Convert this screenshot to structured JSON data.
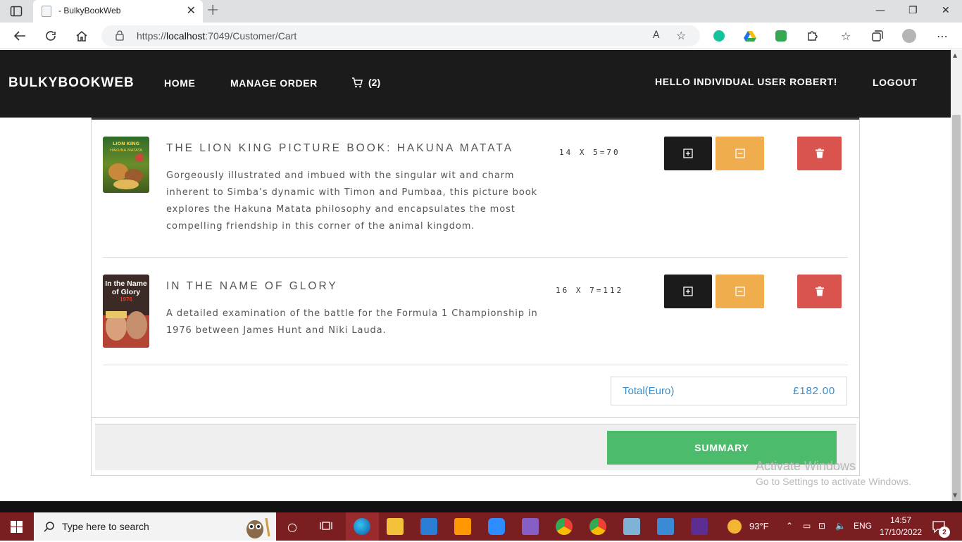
{
  "browser": {
    "tab_title": "- BulkyBookWeb",
    "tab_close": "✕",
    "new_tab": "+",
    "url_prefix": "https://",
    "url_host": "localhost",
    "url_rest": ":7049/Customer/Cart",
    "read_aloud": "A",
    "minimize": "—",
    "restore": "❐",
    "close": "✕"
  },
  "nav": {
    "brand": "BULKYBOOKWEB",
    "home": "HOME",
    "manage_order": "MANAGE ORDER",
    "cart_count": "(2)",
    "greeting": "HELLO INDIVIDUAL USER ROBERT!",
    "logout": "LOGOUT"
  },
  "cart": {
    "items": [
      {
        "title": "THE LION KING PICTURE BOOK: HAKUNA MATATA",
        "description": "Gorgeously illustrated and imbued with the singular wit and charm inherent to Simba’s dynamic with Timon and Pumbaa, this picture book explores the Hakuna Matata philosophy and encapsulates the most compelling friendship in this corner of the animal kingdom.",
        "qty_text": "14 X 5=70",
        "cover_text": "LION KING HAKUNA MATATA"
      },
      {
        "title": "IN THE NAME OF GLORY",
        "description": "A detailed examination of the battle for the Formula 1 Championship in 1976 between James Hunt and Niki Lauda.",
        "qty_text": "16 X 7=112",
        "cover_text_1": "In the Name",
        "cover_text_2": "of Glory",
        "cover_text_3": "1976"
      }
    ],
    "total_label": "Total(Euro)",
    "total_value": "£182.00",
    "summary_label": "SUMMARY"
  },
  "watermark": {
    "line1": "Activate Windows",
    "line2": "Go to Settings to activate Windows."
  },
  "taskbar": {
    "search_placeholder": "Type here to search",
    "weather": "93°F",
    "language": "ENG",
    "time": "14:57",
    "date": "17/10/2022",
    "notifications": "2"
  },
  "colors": {
    "navbar": "#1b1b1b",
    "plus_button": "#1b1b1b",
    "minus_button": "#f0ad4e",
    "delete_button": "#d9534f",
    "summary_button": "#4cbb6c",
    "total_text": "#3a8bc7",
    "taskbar": "#7b1e22"
  }
}
